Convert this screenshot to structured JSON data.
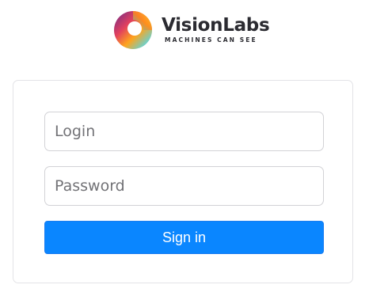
{
  "brand": {
    "name": "VisionLabs",
    "tagline": "MACHINES CAN SEE",
    "logo_icon": "visionlabs-ring-logo-icon",
    "colors": [
      "#7b2a8c",
      "#e8465c",
      "#ffb21e",
      "#3fc6d8"
    ]
  },
  "form": {
    "login_placeholder": "Login",
    "login_value": "",
    "password_placeholder": "Password",
    "password_value": "",
    "submit_label": "Sign in"
  },
  "theme": {
    "accent": "#0a86ff",
    "field_border": "#d2d2d6",
    "card_border": "#e3e3e7"
  }
}
